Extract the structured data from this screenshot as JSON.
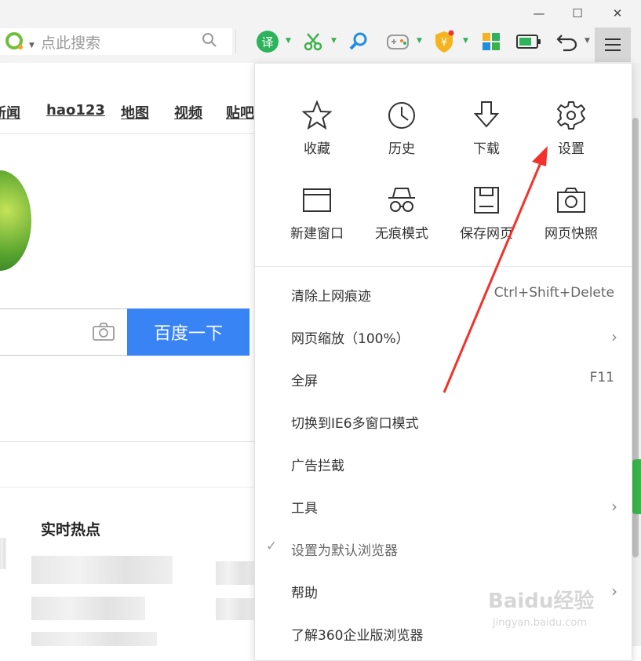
{
  "window": {
    "minimize": "—",
    "maximize": "☐",
    "close": "✕"
  },
  "toolbar": {
    "search_placeholder": "点此搜索",
    "translate_label": "译",
    "menu_icon": "hamburger-icon"
  },
  "page": {
    "nav": [
      "新闻",
      "hao123",
      "地图",
      "视频",
      "贴吧"
    ],
    "search_button": "百度一下",
    "hot_title": "实时热点"
  },
  "menu": {
    "tiles": [
      {
        "label": "收藏",
        "icon": "star-icon"
      },
      {
        "label": "历史",
        "icon": "clock-icon"
      },
      {
        "label": "下载",
        "icon": "download-icon"
      },
      {
        "label": "设置",
        "icon": "gear-icon"
      },
      {
        "label": "新建窗口",
        "icon": "window-icon"
      },
      {
        "label": "无痕模式",
        "icon": "incognito-icon"
      },
      {
        "label": "保存网页",
        "icon": "save-icon"
      },
      {
        "label": "网页快照",
        "icon": "camera-icon"
      }
    ],
    "items": [
      {
        "label": "清除上网痕迹",
        "shortcut": "Ctrl+Shift+Delete"
      },
      {
        "label": "网页缩放（100%）",
        "submenu": "›"
      },
      {
        "label": "全屏",
        "shortcut": "F11"
      },
      {
        "label": "切换到IE6多窗口模式"
      },
      {
        "label": "广告拦截"
      },
      {
        "label": "工具",
        "submenu": "›"
      },
      {
        "label": "设置为默认浏览器",
        "check": "✓"
      },
      {
        "label": "帮助",
        "submenu": "›"
      },
      {
        "label": "了解360企业版浏览器"
      }
    ]
  },
  "watermark": {
    "brand": "Baidu经验",
    "url": "jingyan.baidu.com"
  },
  "colors": {
    "accent_blue": "#3884f5",
    "arrow_red": "#f2322b",
    "toolbar_bg": "#f3f3f3"
  }
}
